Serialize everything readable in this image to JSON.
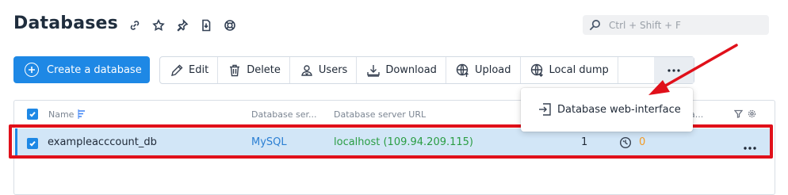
{
  "header": {
    "title": "Databases",
    "icons": [
      "link-icon",
      "star-icon",
      "pin-icon",
      "download-doc-icon",
      "lifebuoy-icon"
    ]
  },
  "search": {
    "placeholder": "Ctrl + Shift + F"
  },
  "toolbar": {
    "create_label": "Create a database",
    "edit_label": "Edit",
    "delete_label": "Delete",
    "users_label": "Users",
    "download_label": "Download",
    "upload_label": "Upload",
    "local_dump_label": "Local dump",
    "more_icon": "more-icon"
  },
  "dropdown": {
    "item_label": "Database web-interface"
  },
  "table": {
    "columns": {
      "name": "Name",
      "db_server": "Database ser...",
      "db_server_url": "Database server URL",
      "truncated": "a..."
    },
    "rows": [
      {
        "name": "exampleacccount_db",
        "server": "MySQL",
        "url": "localhost (109.94.209.115)",
        "count": "1",
        "alert_value": "0"
      }
    ]
  },
  "colors": {
    "accent": "#1e88e5",
    "row_selected": "#d2e6f7",
    "url_green": "#2a9d43",
    "alert_orange": "#f29a25",
    "annotation_red": "#e0101a"
  }
}
